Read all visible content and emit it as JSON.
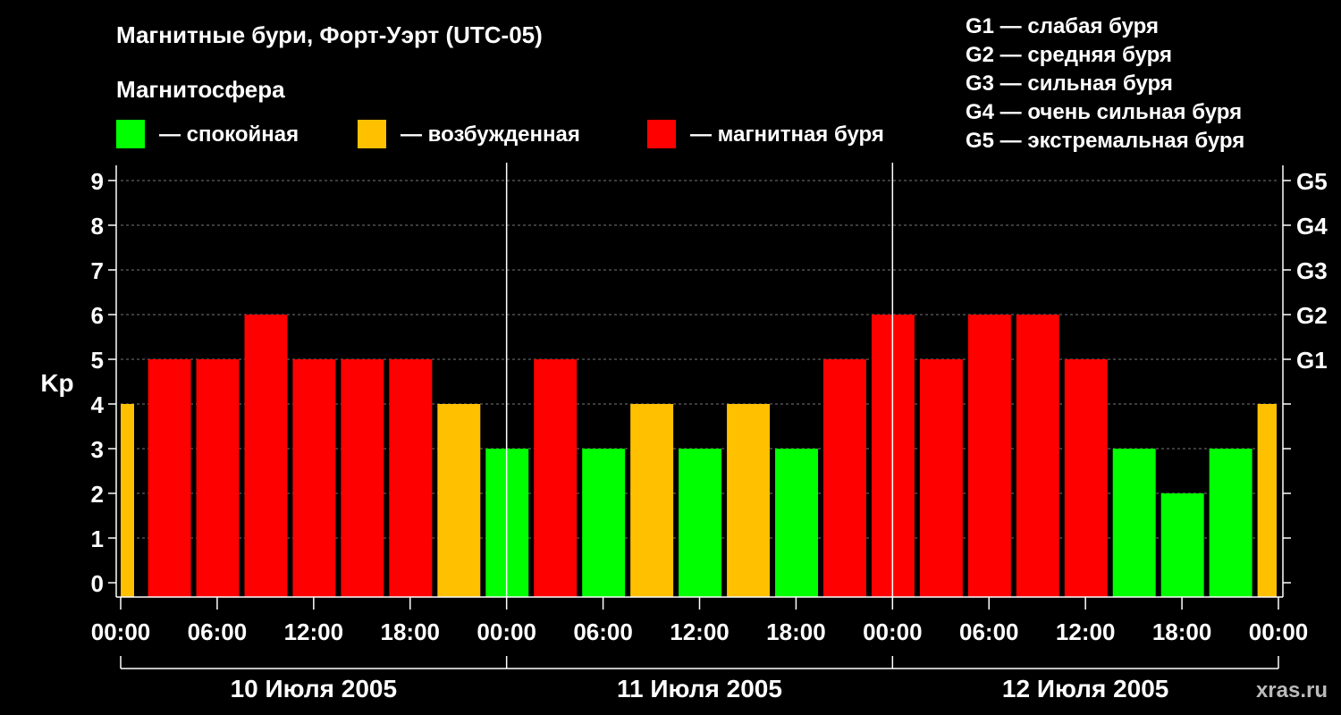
{
  "title": "Магнитные бури, Форт-Уэрт (UTC-05)",
  "legend": {
    "heading": "Магнитосфера",
    "items": [
      {
        "label": "— спокойная",
        "color": "#00ff00"
      },
      {
        "label": "— возбужденная",
        "color": "#ffc000"
      },
      {
        "label": "— магнитная буря",
        "color": "#ff0000"
      }
    ]
  },
  "g_legend": [
    "G1 — слабая буря",
    "G2 — средняя буря",
    "G3 — сильная буря",
    "G4 — очень сильная буря",
    "G5 — экстремальная буря"
  ],
  "watermark": "xras.ru",
  "chart_data": {
    "type": "bar",
    "ylabel": "Kp",
    "ylim": [
      0,
      9
    ],
    "yticks": [
      "0",
      "1",
      "2",
      "3",
      "4",
      "5",
      "6",
      "7",
      "8",
      "9"
    ],
    "right_ticks": [
      {
        "kp": 5,
        "label": "G1"
      },
      {
        "kp": 6,
        "label": "G2"
      },
      {
        "kp": 7,
        "label": "G3"
      },
      {
        "kp": 8,
        "label": "G4"
      },
      {
        "kp": 9,
        "label": "G5"
      }
    ],
    "xticks": [
      "00:00",
      "06:00",
      "12:00",
      "18:00",
      "00:00",
      "06:00",
      "12:00",
      "18:00",
      "00:00",
      "06:00",
      "12:00",
      "18:00",
      "00:00"
    ],
    "days": [
      "10 Июля 2005",
      "11 Июля 2005",
      "12 Июля 2005"
    ],
    "interval_hours": 3,
    "first_bar_partial": true,
    "values": [
      4,
      5,
      5,
      6,
      5,
      5,
      5,
      4,
      3,
      5,
      3,
      4,
      3,
      4,
      3,
      5,
      6,
      5,
      6,
      6,
      5,
      3,
      2,
      3,
      4
    ],
    "colors": {
      "quiet": "#00ff00",
      "active": "#ffc000",
      "storm": "#ff0000"
    },
    "grid": true
  }
}
